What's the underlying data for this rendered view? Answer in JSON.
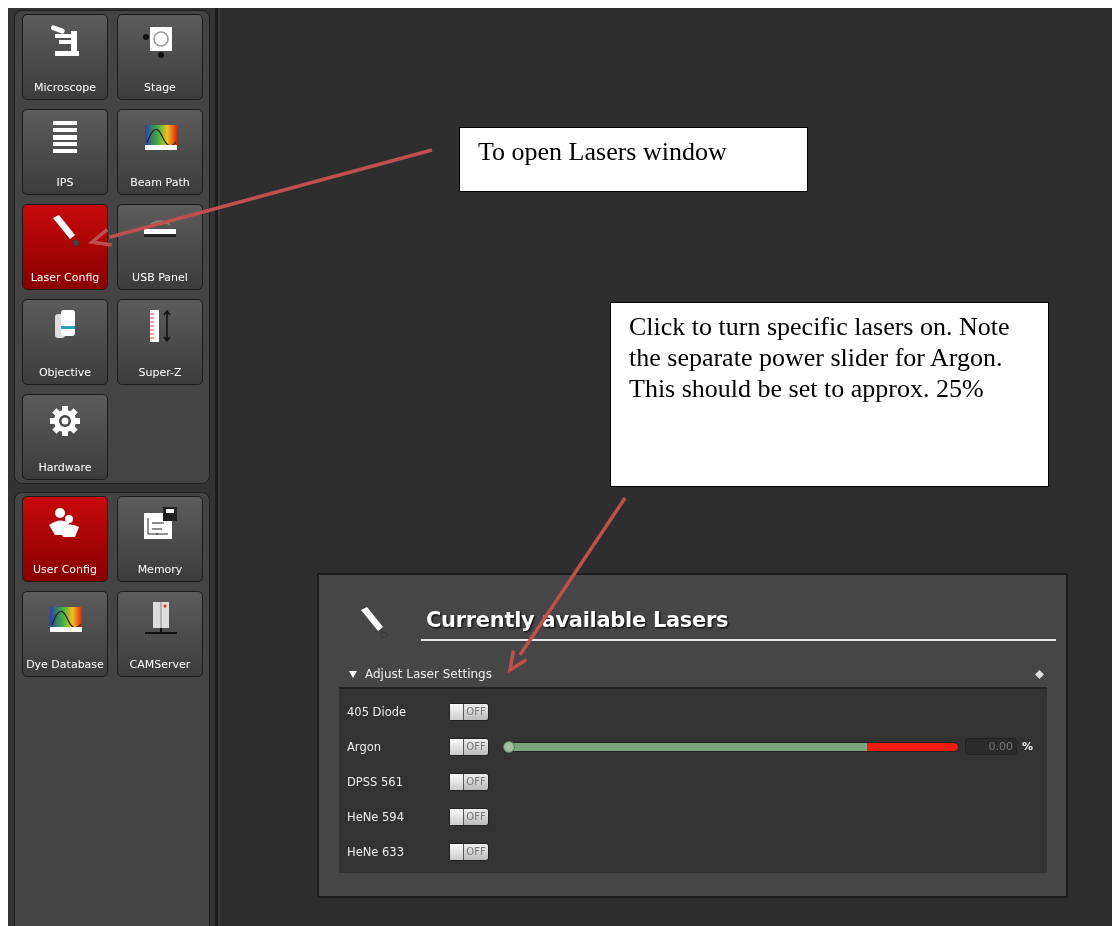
{
  "sidebar": {
    "groups": [
      {
        "tiles": [
          {
            "label": "Microscope",
            "kind": "microscope",
            "selected": false
          },
          {
            "label": "Stage",
            "kind": "stage",
            "selected": false
          },
          {
            "label": "IPS",
            "kind": "list",
            "selected": false
          },
          {
            "label": "Beam Path",
            "kind": "spectrum",
            "selected": false
          },
          {
            "label": "Laser Config",
            "kind": "laser",
            "selected": true
          },
          {
            "label": "USB Panel",
            "kind": "usb",
            "selected": false
          },
          {
            "label": "Objective",
            "kind": "objective",
            "selected": false
          },
          {
            "label": "Super-Z",
            "kind": "ruler",
            "selected": false
          },
          {
            "label": "Hardware",
            "kind": "gear",
            "selected": false
          }
        ]
      },
      {
        "tiles": [
          {
            "label": "User Config",
            "kind": "users",
            "selected": true
          },
          {
            "label": "Memory",
            "kind": "memory",
            "selected": false
          },
          {
            "label": "Dye Database",
            "kind": "spectrum",
            "selected": false
          },
          {
            "label": "CAMServer",
            "kind": "server",
            "selected": false
          }
        ]
      }
    ]
  },
  "laser_panel": {
    "title": "Currently available Lasers",
    "section": {
      "label": "Adjust Laser Settings",
      "expanded": true
    },
    "lasers": [
      {
        "name": "405 Diode",
        "on": false,
        "switch_label": "OFF"
      },
      {
        "name": "Argon",
        "on": false,
        "switch_label": "OFF",
        "slider": {
          "level": 0,
          "value": "0.00",
          "unit": "%"
        }
      },
      {
        "name": "DPSS 561",
        "on": false,
        "switch_label": "OFF"
      },
      {
        "name": "HeNe 594",
        "on": false,
        "switch_label": "OFF"
      },
      {
        "name": "HeNe 633",
        "on": false,
        "switch_label": "OFF"
      }
    ]
  },
  "callouts": [
    {
      "text": "To open Lasers window"
    },
    {
      "text": "Click to turn specific lasers on. Note the separate power slider for Argon. This should be set to approx. 25%"
    }
  ]
}
